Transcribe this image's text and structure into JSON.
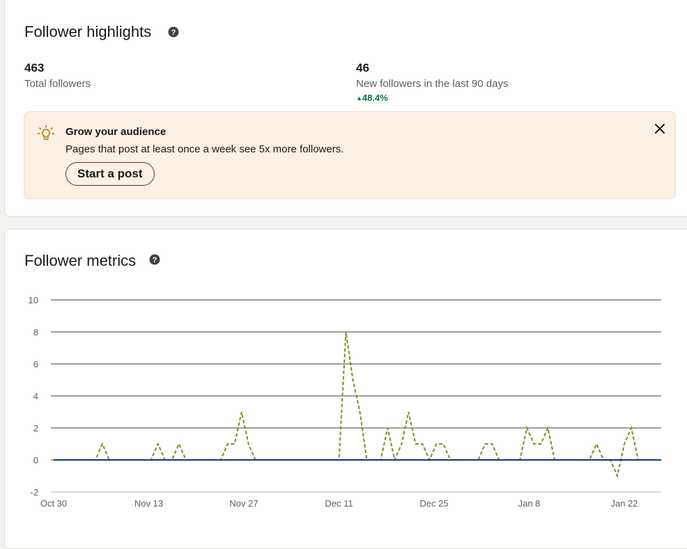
{
  "highlights": {
    "title": "Follower highlights",
    "total_followers": {
      "value": "463",
      "label": "Total followers"
    },
    "new_followers": {
      "value": "46",
      "label": "New followers in the last 90 days",
      "change": "48.4%"
    },
    "banner": {
      "title": "Grow your audience",
      "text": "Pages that post at least once a week see 5x more followers.",
      "button_label": "Start a post"
    }
  },
  "metrics": {
    "title": "Follower metrics"
  },
  "colors": {
    "series": "#7a8f1f",
    "baseline": "#0a3d7a",
    "grid": "#404040",
    "positive": "#057642"
  },
  "chart_data": {
    "type": "line",
    "title": "",
    "xlabel": "",
    "ylabel": "",
    "ylim": [
      -2,
      10
    ],
    "yticks": [
      "10",
      "8",
      "6",
      "4",
      "2",
      "0",
      "-2"
    ],
    "xticks": [
      "Oct 30",
      "Nov 13",
      "Nov 27",
      "Dec 11",
      "Dec 25",
      "Jan 8",
      "Jan 22"
    ],
    "x_start": "Oct 30",
    "x_end": "Jan 27",
    "series": [
      {
        "style": "dashed",
        "values": [
          0,
          0,
          0,
          0,
          0,
          0,
          0,
          1,
          0,
          0,
          0,
          0,
          0,
          0,
          0,
          1,
          0,
          0,
          1,
          0,
          0,
          0,
          0,
          0,
          0,
          1,
          1,
          3,
          1,
          0,
          0,
          0,
          0,
          0,
          0,
          0,
          0,
          0,
          0,
          0,
          0,
          0,
          8,
          5,
          3,
          0,
          0,
          0,
          2,
          0,
          1,
          3,
          1,
          1,
          0,
          1,
          1,
          0,
          0,
          0,
          0,
          0,
          1,
          1,
          0,
          0,
          0,
          0,
          2,
          1,
          1,
          2,
          0,
          0,
          0,
          0,
          0,
          0,
          1,
          0,
          0,
          -1,
          1,
          2,
          0
        ]
      },
      {
        "style": "solid",
        "values": [
          0,
          0,
          0,
          0,
          0,
          0,
          0,
          0,
          0,
          0,
          0,
          0,
          0,
          0,
          0,
          0,
          0,
          0,
          0,
          0,
          0,
          0,
          0,
          0,
          0,
          0,
          0,
          0,
          0,
          0,
          0,
          0,
          0,
          0,
          0,
          0,
          0,
          0,
          0,
          0,
          0,
          0,
          0,
          0,
          0,
          0,
          0,
          0,
          0,
          0,
          0,
          0,
          0,
          0,
          0,
          0,
          0,
          0,
          0,
          0,
          0,
          0,
          0,
          0,
          0,
          0,
          0,
          0,
          0,
          0,
          0,
          0,
          0,
          0,
          0,
          0,
          0,
          0,
          0,
          0,
          0,
          0,
          0,
          0,
          0,
          0,
          0,
          0,
          0,
          0,
          0
        ]
      }
    ]
  }
}
